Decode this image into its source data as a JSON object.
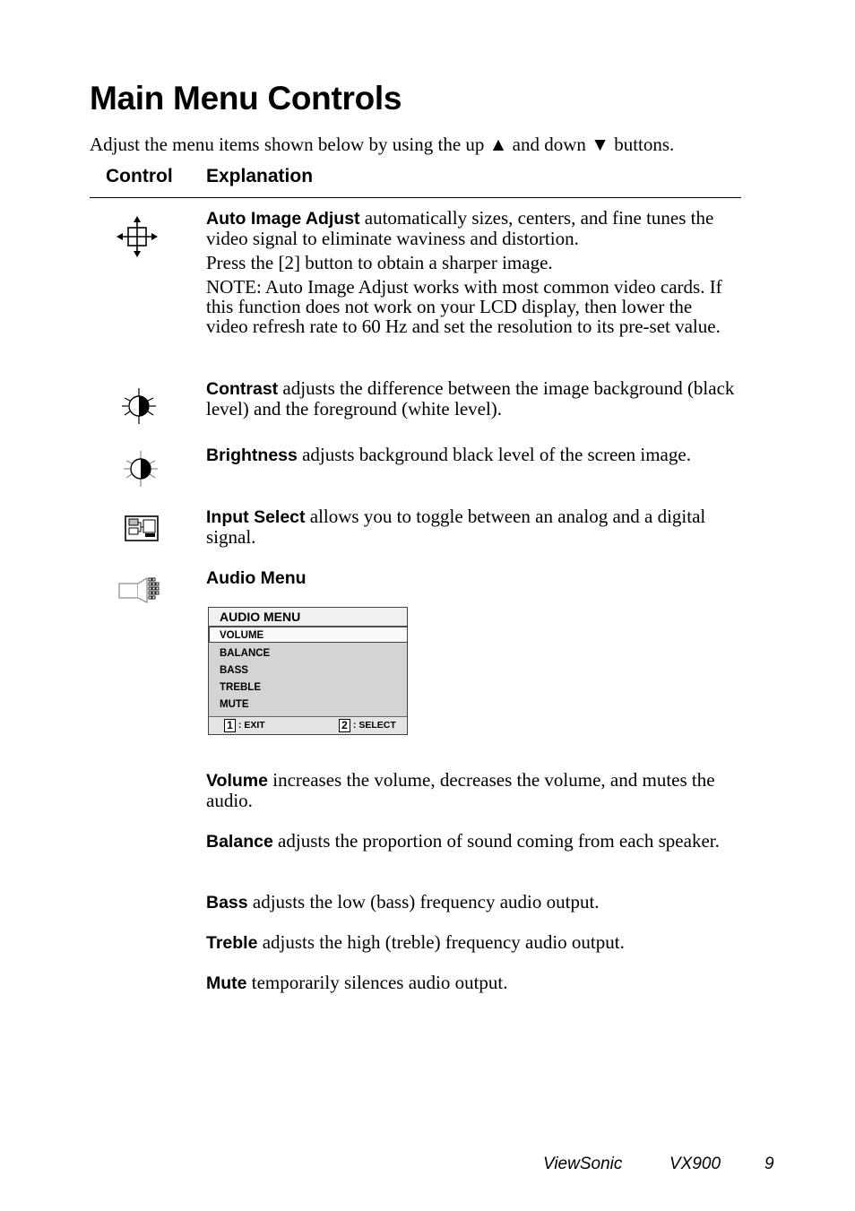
{
  "page": {
    "title": "Main Menu Controls",
    "intro": "Adjust the menu items shown below by using the up ▲ and down ▼ buttons.",
    "columns": {
      "control": "Control",
      "explanation": "Explanation"
    }
  },
  "controls": [
    {
      "icon": "auto-image-adjust-icon",
      "term": "Auto Image Adjust",
      "text": " automatically sizes, centers, and fine tunes the video signal to eliminate waviness and distortion.",
      "extra": [
        "Press the [2] button to obtain a sharper image.",
        "NOTE: Auto Image Adjust works with most common video cards. If this function does not work on your LCD display, then lower the video refresh rate to 60 Hz and set the resolution to its pre-set value."
      ]
    },
    {
      "icon": "contrast-icon",
      "term": "Contrast",
      "text": " adjusts the difference between the image background (black level) and the foreground (white level)."
    },
    {
      "icon": "brightness-icon",
      "term": "Brightness",
      "text": " adjusts background black level of the screen image."
    },
    {
      "icon": "input-select-icon",
      "term": "Input Select",
      "text": " allows you to toggle between an analog and a digital signal."
    },
    {
      "icon": "audio-menu-icon",
      "term": "Audio Menu",
      "text": ""
    }
  ],
  "audio_menu": {
    "title": "AUDIO MENU",
    "items": [
      "VOLUME",
      "BALANCE",
      "BASS",
      "TREBLE",
      "MUTE"
    ],
    "selected": "VOLUME",
    "footer": {
      "exit_key": "1",
      "exit_label": ": EXIT",
      "select_key": "2",
      "select_label": ": SELECT"
    }
  },
  "audio_items": [
    {
      "term": "Volume",
      "text": " increases the volume, decreases the volume, and mutes the audio."
    },
    {
      "term": "Balance",
      "text": " adjusts the proportion of sound coming from each speaker."
    },
    {
      "term": "Bass",
      "text": " adjusts the low (bass) frequency audio output."
    },
    {
      "term": "Treble",
      "text": " adjusts the high (treble) frequency audio output."
    },
    {
      "term": "Mute",
      "text": " temporarily silences audio output."
    }
  ],
  "footer": {
    "brand": "ViewSonic",
    "model": "VX900",
    "page_number": "9"
  }
}
